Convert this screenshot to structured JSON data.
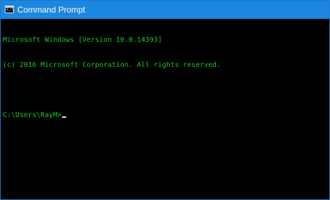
{
  "window": {
    "title": "Command Prompt",
    "icon": "command-prompt-icon",
    "accent_color": "#1d86e0"
  },
  "console": {
    "text_color": "#19c62c",
    "background_color": "#000000",
    "lines": [
      "Microsoft Windows [Version 10.0.14393]",
      "(c) 2016 Microsoft Corporation. All rights reserved.",
      "",
      "C:\\Users\\RayM>"
    ]
  }
}
